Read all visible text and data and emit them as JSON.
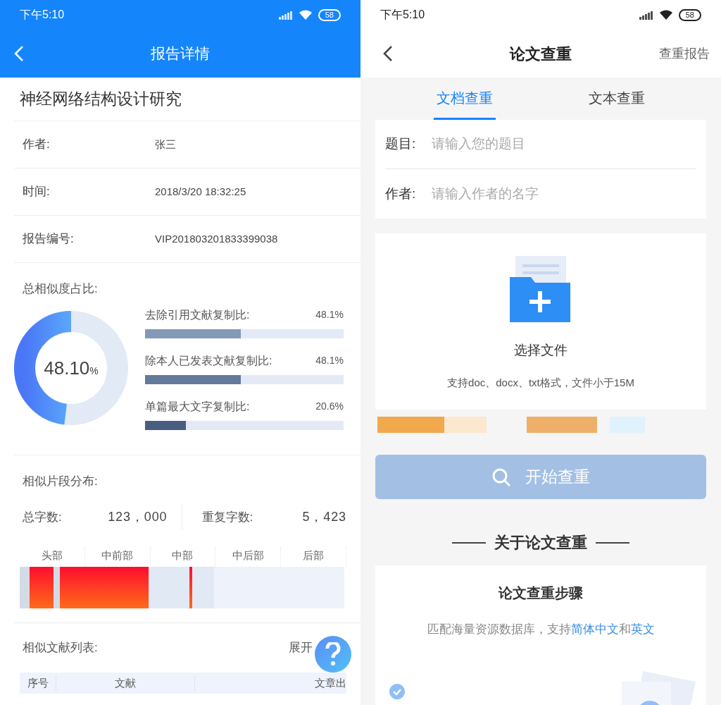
{
  "left": {
    "status_bar": {
      "time": "下午5:10",
      "battery": "58"
    },
    "nav": {
      "title": "报告详情"
    },
    "report_title": "神经网络结构设计研究",
    "info_rows": [
      {
        "label": "作者:",
        "value": "张三"
      },
      {
        "label": "时间:",
        "value": "2018/3/20 18:32:25"
      },
      {
        "label": "报告编号:",
        "value": "VIP201803201833399038"
      }
    ],
    "similarity": {
      "label": "总相似度占比:",
      "total": "48.10",
      "unit": "%",
      "level": 0.481,
      "bars": [
        {
          "label": "去除引用文献复制比:",
          "reading": "48.1%",
          "level": 0.481,
          "color": "#8399b8"
        },
        {
          "label": "除本人已发表文献复制比:",
          "reading": "48.1%",
          "level": 0.481,
          "color": "#637a9b"
        },
        {
          "label": "单篇最大文字复制比:",
          "reading": "20.6%",
          "level": 0.206,
          "color": "#475e80"
        }
      ]
    },
    "distribution": {
      "label": "相似片段分布:",
      "stats": [
        {
          "label": "总字数:",
          "value": "123，000"
        },
        {
          "label": "重复字数:",
          "value": "5，423"
        }
      ],
      "segments": [
        "头部",
        "中前部",
        "中部",
        "中后部",
        "后部"
      ]
    },
    "literature": {
      "label": "相似文献列表:",
      "toggle": "展开",
      "columns": [
        "序号",
        "文献",
        "文章出"
      ]
    }
  },
  "right": {
    "status_bar": {
      "time": "下午5:10",
      "battery": "58"
    },
    "nav": {
      "title": "论文查重",
      "action": "查重报告"
    },
    "tabs": [
      {
        "label": "文档查重",
        "selected": true
      },
      {
        "label": "文本查重",
        "selected": false
      }
    ],
    "form": [
      {
        "label": "题目:",
        "placeholder": "请输入您的题目"
      },
      {
        "label": "作者:",
        "placeholder": "请输入作者的名字"
      }
    ],
    "upload": {
      "title": "选择文件",
      "hint": "支持doc、docx、txt格式，文件小于15M"
    },
    "start_button": "开始查重",
    "about": {
      "heading": "关于论文查重",
      "card_title": "论文查重步骤",
      "card_text": "匹配海量资源数据库，支持**简体中文**和**英文**"
    }
  }
}
